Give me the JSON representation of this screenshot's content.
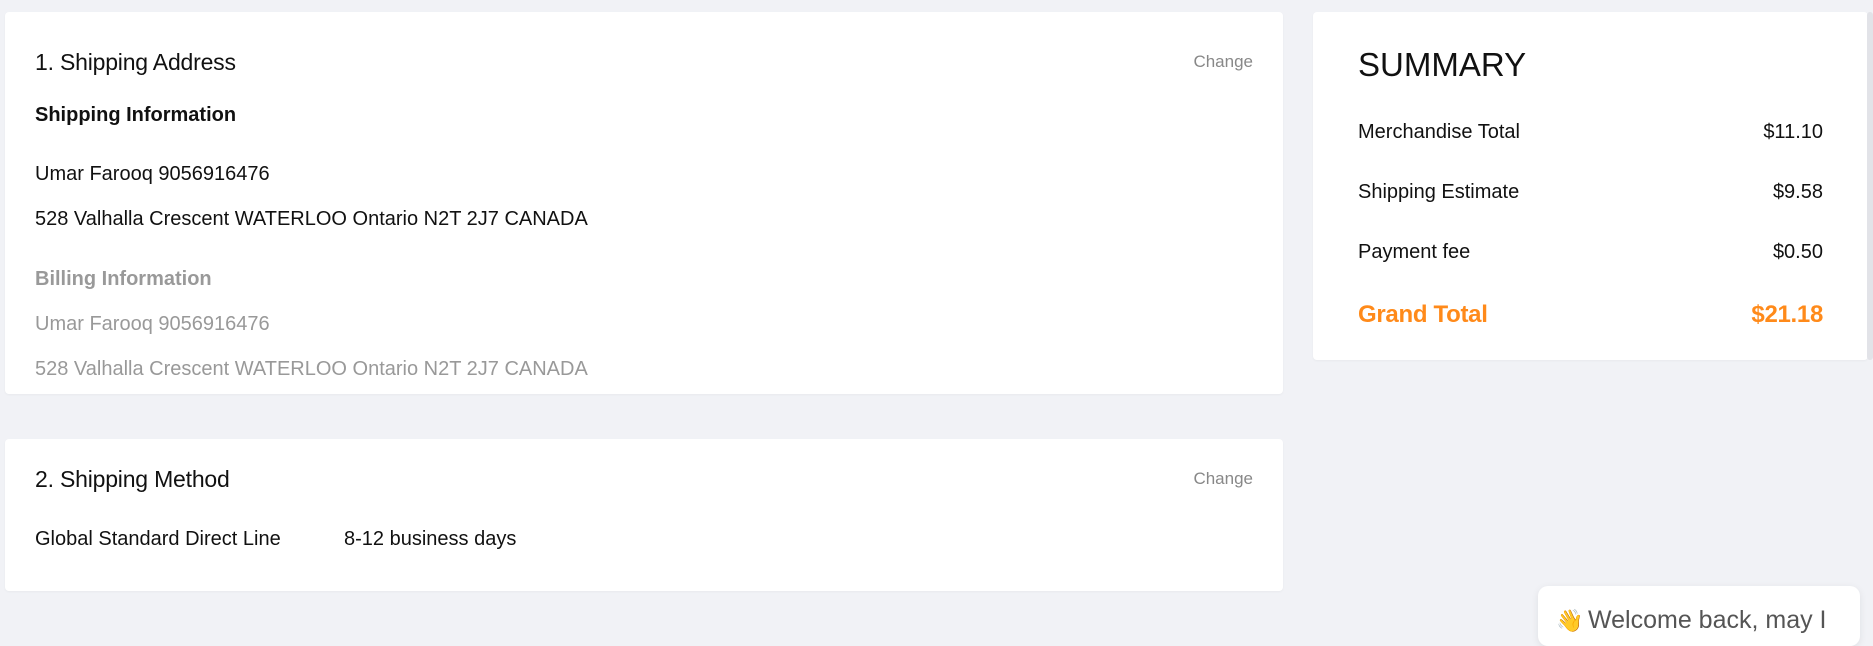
{
  "shipping_address": {
    "title": "1. Shipping Address",
    "change_label": "Change",
    "shipping_info": {
      "heading": "Shipping Information",
      "name_phone": "Umar Farooq 9056916476",
      "address": "528 Valhalla Crescent WATERLOO Ontario N2T 2J7 CANADA"
    },
    "billing_info": {
      "heading": "Billing Information",
      "name_phone": "Umar Farooq 9056916476",
      "address": "528 Valhalla Crescent WATERLOO Ontario N2T 2J7 CANADA"
    }
  },
  "shipping_method": {
    "title": "2. Shipping Method",
    "change_label": "Change",
    "method_name": "Global Standard Direct Line",
    "delivery_time": "8-12 business days"
  },
  "summary": {
    "title": "SUMMARY",
    "merchandise_label": "Merchandise Total",
    "merchandise_value": "$11.10",
    "shipping_label": "Shipping Estimate",
    "shipping_value": "$9.58",
    "payment_label": "Payment fee",
    "payment_value": "$0.50",
    "grand_label": "Grand Total",
    "grand_value": "$21.18",
    "accent_color": "#ff8a1a"
  },
  "chat": {
    "icon": "waving-hand-icon",
    "message": "Welcome back, may I"
  }
}
